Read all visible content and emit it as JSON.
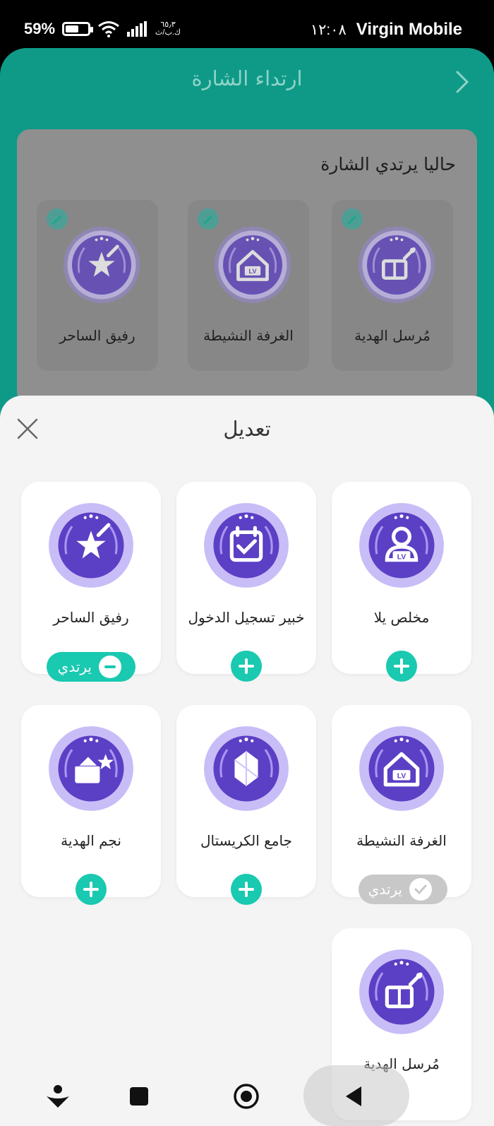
{
  "status_bar": {
    "battery_text": "59",
    "battery_percent": 59,
    "net_speed_value": "٦٥٫٣",
    "net_speed_unit": "ك.ب/ث",
    "time": "١٢:٠٨",
    "carrier": "Virgin Mobile"
  },
  "header": {
    "title": "ارتداء الشارة",
    "back_icon": "chevron-right-icon"
  },
  "wearing": {
    "title": "حاليا يرتدي الشارة",
    "items": [
      {
        "name": "مُرسل الهدية",
        "icon": "gift-wand-badge"
      },
      {
        "name": "الغرفة النشيطة",
        "icon": "house-lv-badge"
      },
      {
        "name": "رفيق الساحر",
        "icon": "star-wand-badge"
      }
    ]
  },
  "sheet": {
    "title": "تعديل",
    "close_icon": "close-icon",
    "cards": [
      {
        "name": "مخلص يلا",
        "icon": "person-lv-badge",
        "state": "add"
      },
      {
        "name": "خبير تسجيل الدخول",
        "icon": "calendar-check-badge",
        "state": "add"
      },
      {
        "name": "رفيق الساحر",
        "icon": "star-wand-badge",
        "state": "wearing",
        "pill_label": "يرتدي"
      },
      {
        "name": "الغرفة النشيطة",
        "icon": "house-lv-badge",
        "state": "worn",
        "pill_label": "يرتدي"
      },
      {
        "name": "جامع الكريستال",
        "icon": "crystal-badge",
        "state": "add"
      },
      {
        "name": "نجم الهدية",
        "icon": "gift-star-badge",
        "state": "add"
      },
      {
        "name": "مُرسل الهدية",
        "icon": "gift-wand-badge",
        "state": "worn"
      }
    ]
  },
  "nav": {
    "buttons": [
      "back-icon",
      "home-icon",
      "recents-icon",
      "assistant-icon"
    ]
  },
  "colors": {
    "teal": "#0f9a88",
    "accent": "#19c9b0",
    "badge_purple": "#5b3fc4",
    "badge_rim": "#9b86f0"
  }
}
